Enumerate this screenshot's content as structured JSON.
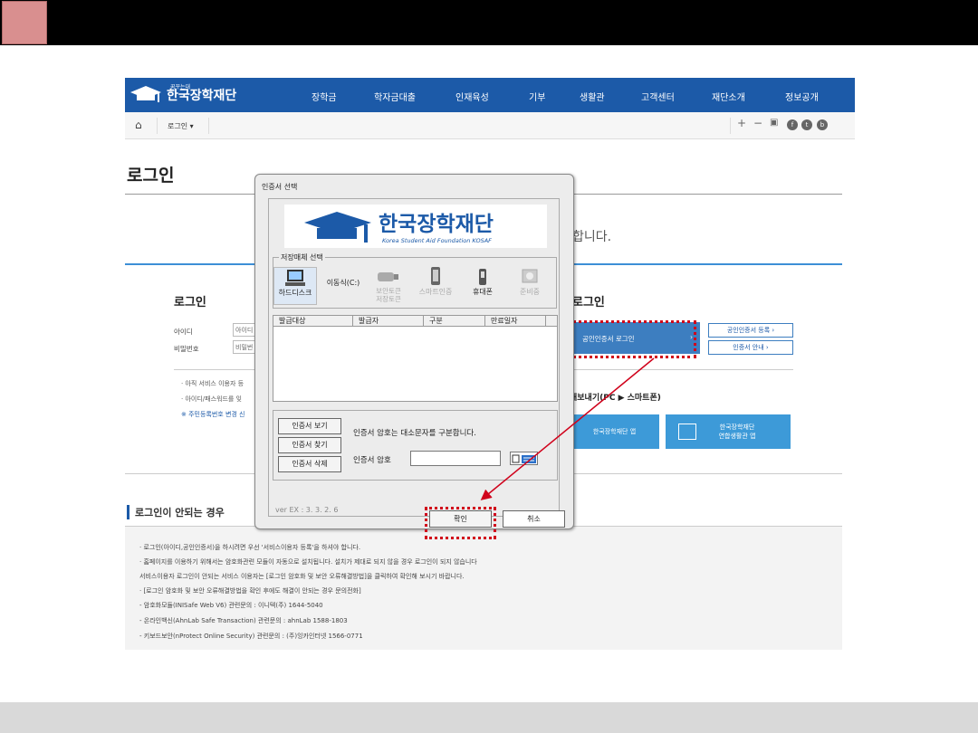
{
  "slide": {
    "accent_color": "#d98f8f"
  },
  "site": {
    "logo_small": "꿈꾸는대",
    "logo_text": "한국장학재단",
    "nav": [
      "장학금",
      "학자금대출",
      "인재육성",
      "기부",
      "생활관",
      "고객센터",
      "재단소개",
      "정보공개"
    ],
    "breadcrumb": "로그인",
    "toolbar_icons": [
      "plus-icon",
      "minus-icon",
      "print-icon",
      "facebook-icon",
      "twitter-icon",
      "blog-icon"
    ],
    "page_title": "로그인",
    "welcome_text": "합니다.",
    "login_heading": "로그인",
    "id_label": "아이디",
    "pw_label": "비밀번호",
    "id_placeholder": "아이디",
    "pw_placeholder": "비밀번",
    "notes": [
      "· 아직 서비스 이용자 등",
      "· 아이디/패스워드를 잊",
      "※ 주민등록번호 변경 신"
    ],
    "cert_heading": "로그인",
    "cert_login_btn": "공인인증서 로그인",
    "cert_register_btn": "공인인증서 등록",
    "cert_guide_btn": "인증서 안내",
    "app_line": "내보내기(PC ▶ 스마트폰)",
    "app_btn1": "한국장학재단 앱",
    "app_btn2_l1": "한국장학재단",
    "app_btn2_l2": "연합생활관 앱",
    "trouble_heading": "로그인이 안되는 경우",
    "faq": [
      "· 로그인(아이디,공인인증서)을 하시려면 우선 '서비스이용자 등록'을 하셔야 합니다.",
      "· 홈페이지를 이용하기 위해서는 암호화관련 모듈이 자동으로 설치됩니다. 설치가 제대로 되지 않을 경우 로그인이 되지 않습니다",
      "  서비스이용자 로그인이 안되는 서비스 이용자는 [로그인 암호화 및 보안 오류해결방법]을 클릭하여 확인해 보시기 바랍니다.",
      "· [로그인 암호화 및 보안 오류해결방법을 확인 후에도 해결이 안되는 경우 문의전화]",
      "  - 암호화모듈(INISafe Web V6) 관련문의 : 이니텍(주) 1644-5040",
      "  - 온라인백신(AhnLab Safe Transaction) 관련문의 : ahnLab 1588-1803",
      "  - 키보드보안(nProtect Online Security) 관련문의 : (주)잉카인터넷 1566-0771"
    ]
  },
  "dialog": {
    "title": "인증서 선택",
    "banner_korean": "한국장학재단",
    "banner_english": "Korea Student Aid Foundation KOSAF",
    "storage_legend": "저장매체 선택",
    "devices": [
      "하드디스크",
      "이동식(C:)",
      "보안토큰\n저장토큰",
      "스마트인증",
      "휴대폰",
      "준비중"
    ],
    "columns": [
      "발급대상",
      "발급자",
      "구분",
      "만료일자"
    ],
    "buttons": [
      "인증서 보기",
      "인증서 찾기",
      "인증서 삭제"
    ],
    "pw_note": "인증서 암호는 대소문자를 구분합니다.",
    "pw_label": "인증서 암호",
    "ok": "확인",
    "cancel": "취소",
    "version": "ver EX : 3. 3. 2. 6"
  },
  "annotation": {
    "highlight_color": "#d0021b"
  }
}
